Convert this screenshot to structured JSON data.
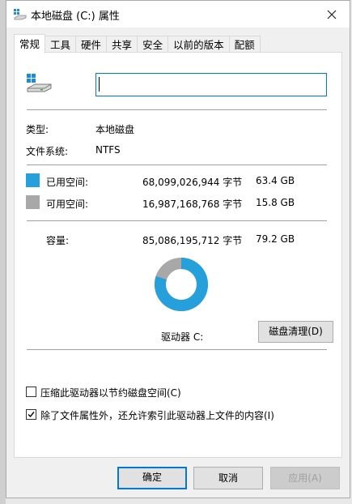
{
  "window": {
    "title": "本地磁盘 (C:) 属性",
    "icon": "drive-icon",
    "close_icon": "close-icon"
  },
  "tabs": [
    {
      "label": "常规",
      "active": true
    },
    {
      "label": "工具",
      "active": false
    },
    {
      "label": "硬件",
      "active": false
    },
    {
      "label": "共享",
      "active": false
    },
    {
      "label": "安全",
      "active": false
    },
    {
      "label": "以前的版本",
      "active": false
    },
    {
      "label": "配额",
      "active": false
    }
  ],
  "general": {
    "name_value": "",
    "type_label": "类型:",
    "type_value": "本地磁盘",
    "fs_label": "文件系统:",
    "fs_value": "NTFS",
    "used": {
      "label": "已用空间:",
      "bytes": "68,099,026,944 字节",
      "size": "63.4 GB",
      "color": "#26a0da"
    },
    "free": {
      "label": "可用空间:",
      "bytes": "16,987,168,768 字节",
      "size": "15.8 GB",
      "color": "#a8a8a8"
    },
    "capacity": {
      "label": "容量:",
      "bytes": "85,086,195,712 字节",
      "size": "79.2 GB"
    },
    "used_fraction": 0.8004,
    "drive_label": "驱动器 C:",
    "cleanup_button": "磁盘清理(D)",
    "compress_checkbox": {
      "label": "压缩此驱动器以节约磁盘空间(C)",
      "checked": false
    },
    "index_checkbox": {
      "label": "除了文件属性外，还允许索引此驱动器上文件的内容(I)",
      "checked": true
    }
  },
  "buttons": {
    "ok": "确定",
    "cancel": "取消",
    "apply": "应用(A)"
  }
}
